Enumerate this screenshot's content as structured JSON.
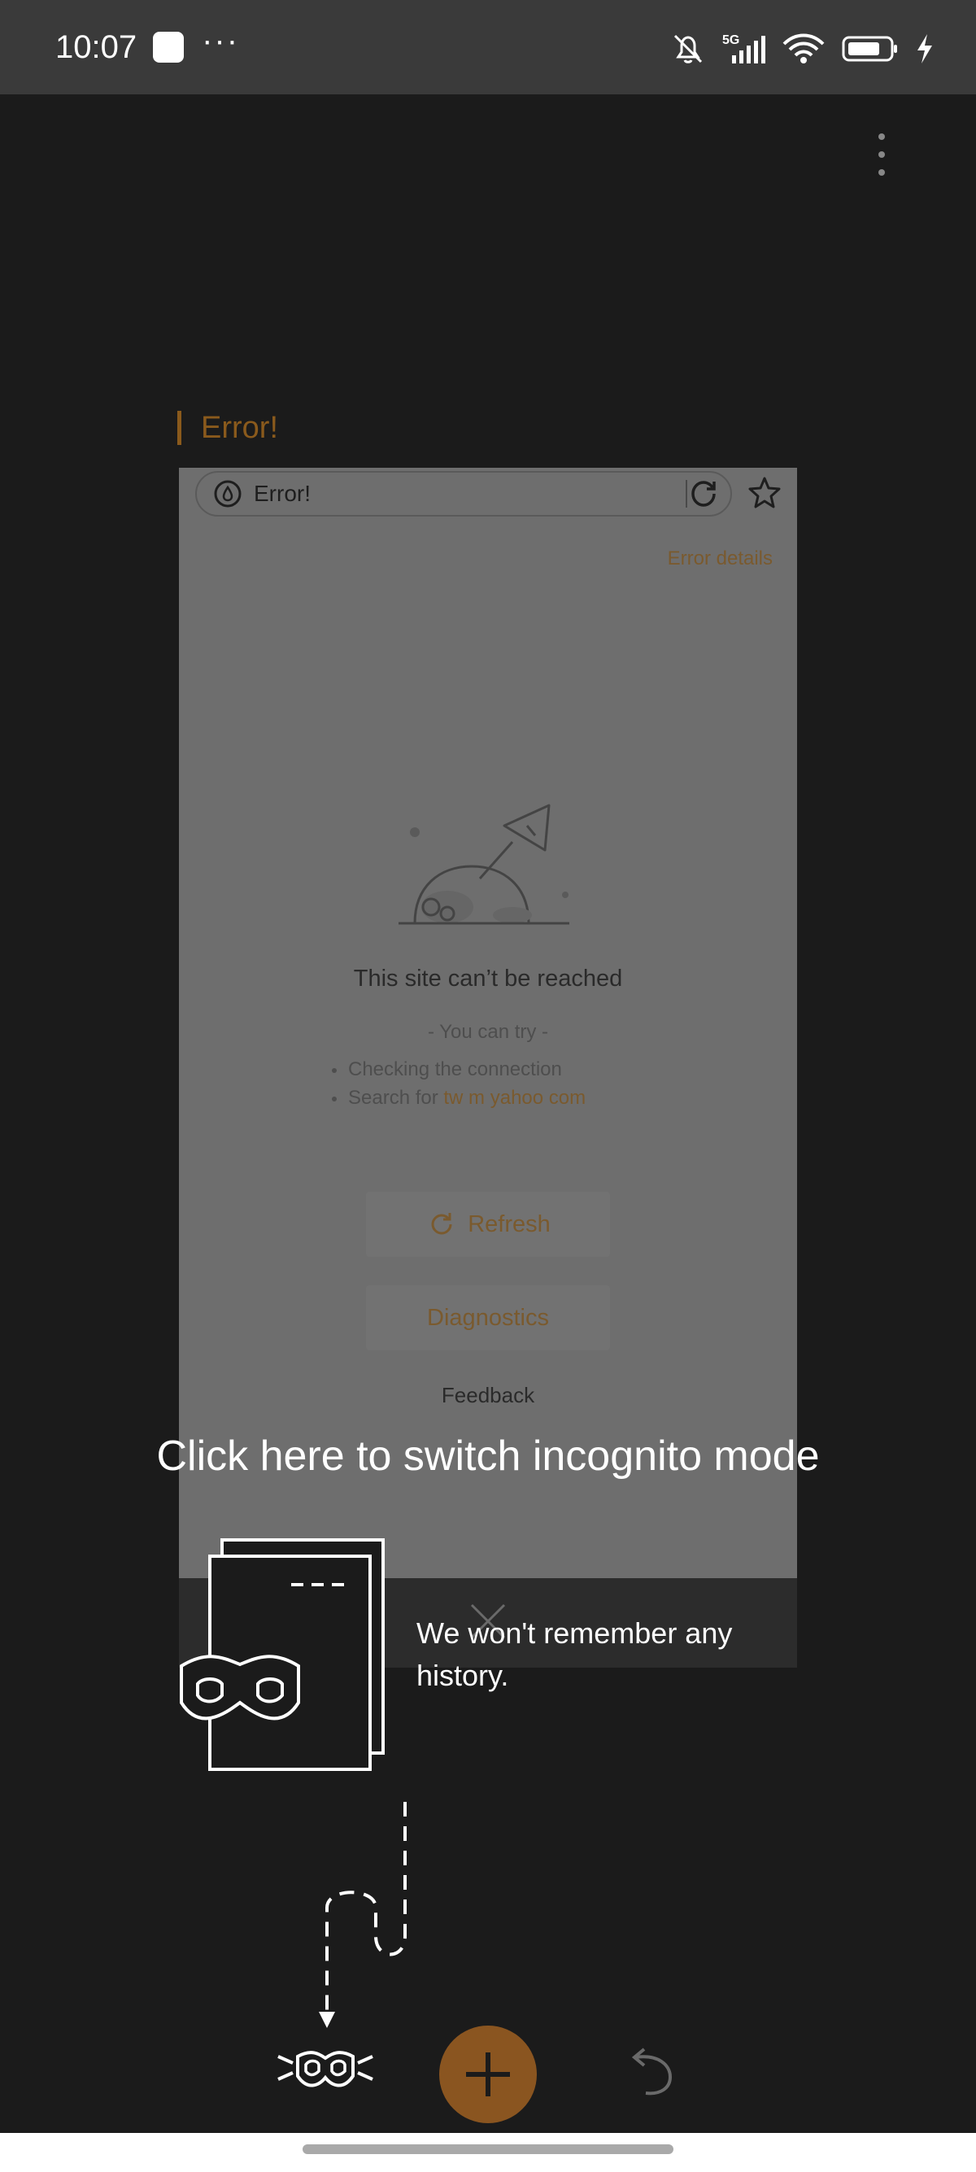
{
  "status_bar": {
    "time": "10:07",
    "dots": "···",
    "network": "5G",
    "icons": [
      "square-notification-icon",
      "bell-muted-icon",
      "signal-icon",
      "wifi-icon",
      "battery-icon",
      "charging-icon"
    ]
  },
  "tab": {
    "title": "Error!",
    "url_text": "Error!",
    "error_details": "Error details",
    "headline": "This site can’t be reached",
    "you_can_try": "- You can try -",
    "tip_1": "Checking the connection",
    "tip_2_prefix": "Search for ",
    "tip_2_link": "tw m yahoo com",
    "refresh_label": "Refresh",
    "diagnostics_label": "Diagnostics",
    "feedback_label": "Feedback"
  },
  "coach_mark": {
    "title": "Click here to switch incognito mode",
    "description": "We won't remember any history."
  },
  "colors": {
    "accent": "#8a5520",
    "accent_text": "#8a5a1c",
    "background": "#1b1b1b",
    "status_bar": "#3a3a3a"
  }
}
